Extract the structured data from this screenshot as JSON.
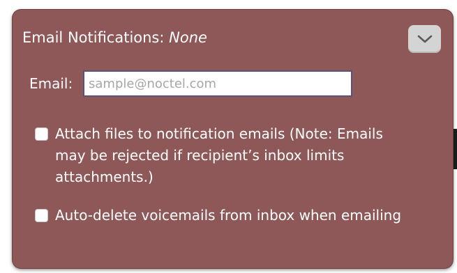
{
  "panel": {
    "title_label": "Email Notifications:",
    "title_value": "None",
    "toggle_icon": "chevron-down-icon"
  },
  "email": {
    "label": "Email:",
    "value": "",
    "placeholder": "sample@noctel.com"
  },
  "options": [
    {
      "label": "Attach files to notification emails (Note: Emails may be rejected if recipient’s inbox limits attachments.)",
      "checked": false
    },
    {
      "label": "Auto-delete voicemails from inbox when emailing",
      "checked": false
    }
  ],
  "colors": {
    "panel_background": "#8e5858",
    "text": "#ffffff",
    "toggle_background": "#d4d4d4",
    "input_border": "#5a5176"
  }
}
